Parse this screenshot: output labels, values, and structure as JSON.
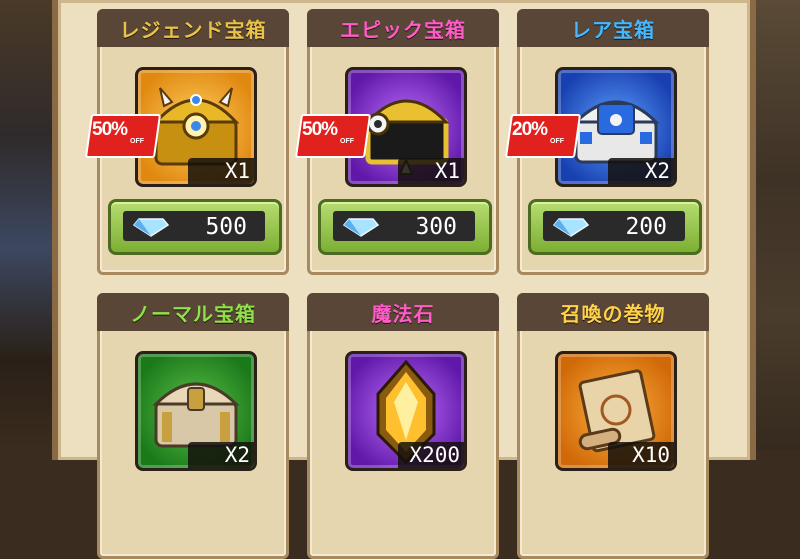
{
  "shop": {
    "items": [
      {
        "title": "レジェンド宝箱",
        "title_color": "#e9c24a",
        "frame_color": "#f0a020",
        "qty": "X1",
        "discount": "50%",
        "discount_suffix": "OFF",
        "price": "500",
        "icon": "legend-chest-icon"
      },
      {
        "title": "エピック宝箱",
        "title_color": "#ff5cc8",
        "frame_color": "#8a2fd0",
        "qty": "X1",
        "discount": "50%",
        "discount_suffix": "OFF",
        "price": "300",
        "icon": "epic-chest-icon"
      },
      {
        "title": "レア宝箱",
        "title_color": "#45b8ff",
        "frame_color": "#2060d8",
        "qty": "X2",
        "discount": "20%",
        "discount_suffix": "OFF",
        "price": "200",
        "icon": "rare-chest-icon"
      },
      {
        "title": "ノーマル宝箱",
        "title_color": "#8fe04a",
        "frame_color": "#2a9a2a",
        "qty": "X2",
        "price": "",
        "icon": "normal-chest-icon"
      },
      {
        "title": "魔法石",
        "title_color": "#ff5cc8",
        "frame_color": "#8a2fd0",
        "qty": "X200",
        "price": "",
        "icon": "magic-stone-icon"
      },
      {
        "title": "召喚の巻物",
        "title_color": "#ffd24a",
        "frame_color": "#f08a18",
        "qty": "X10",
        "price": "",
        "icon": "summon-scroll-icon"
      }
    ]
  }
}
